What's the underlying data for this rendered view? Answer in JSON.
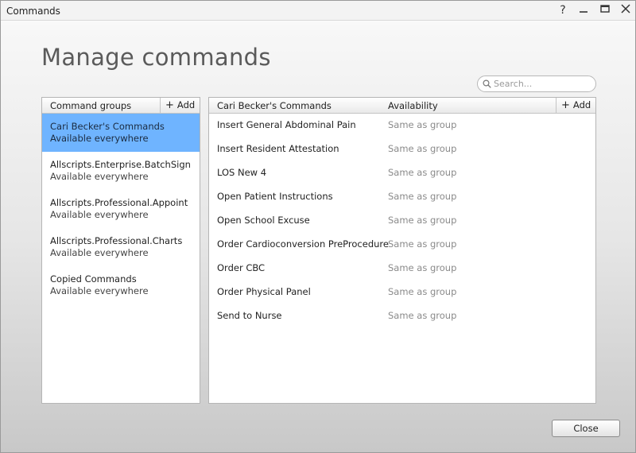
{
  "window": {
    "title": "Commands",
    "help_glyph": "?",
    "minimize_glyph": "—",
    "maximize_glyph": "☐",
    "close_glyph": "✕"
  },
  "page": {
    "heading": "Manage commands"
  },
  "search": {
    "placeholder": "Search...",
    "value": "",
    "icon": "search-icon"
  },
  "groups_panel": {
    "header": "Command groups",
    "add_label": "Add",
    "add_glyph": "+",
    "items": [
      {
        "name": "Cari Becker's Commands",
        "availability": "Available everywhere",
        "selected": true
      },
      {
        "name": "Allscripts.Enterprise.BatchSign",
        "availability": "Available everywhere",
        "selected": false
      },
      {
        "name": "Allscripts.Professional.Appoint",
        "availability": "Available everywhere",
        "selected": false
      },
      {
        "name": "Allscripts.Professional.Charts",
        "availability": "Available everywhere",
        "selected": false
      },
      {
        "name": "Copied Commands",
        "availability": "Available everywhere",
        "selected": false
      }
    ]
  },
  "commands_panel": {
    "header_name": "Cari Becker's Commands",
    "header_availability": "Availability",
    "add_label": "Add",
    "add_glyph": "+",
    "rows": [
      {
        "name": "Insert General Abdominal Pain",
        "availability": "Same as group"
      },
      {
        "name": "Insert Resident Attestation",
        "availability": "Same as group"
      },
      {
        "name": "LOS New 4",
        "availability": "Same as group"
      },
      {
        "name": "Open Patient Instructions",
        "availability": "Same as group"
      },
      {
        "name": "Open School Excuse",
        "availability": "Same as group"
      },
      {
        "name": "Order Cardioconversion PreProcedure",
        "availability": "Same as group"
      },
      {
        "name": "Order CBC",
        "availability": "Same as group"
      },
      {
        "name": "Order Physical Panel",
        "availability": "Same as group"
      },
      {
        "name": "Send to Nurse",
        "availability": "Same as group"
      }
    ]
  },
  "footer": {
    "close_label": "Close"
  },
  "colors": {
    "selection": "#6fb4ff",
    "heading": "#5a5a5a",
    "muted_text": "#8a8a8a"
  }
}
